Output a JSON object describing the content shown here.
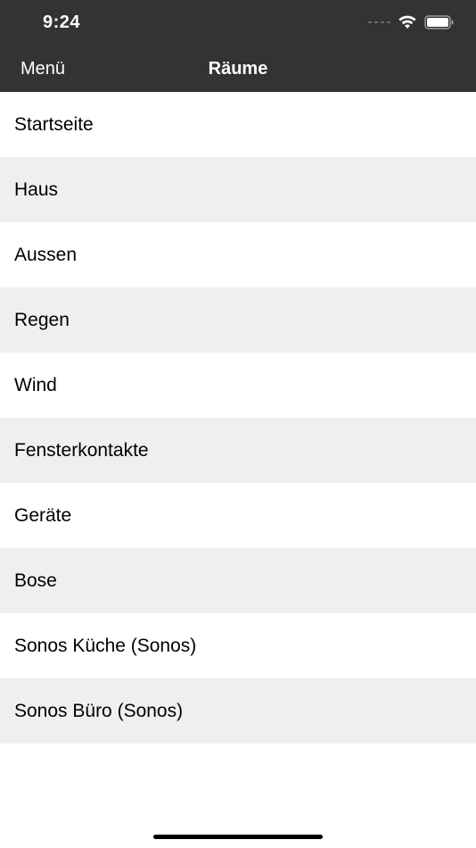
{
  "status_bar": {
    "time": "9:24"
  },
  "nav": {
    "menu_label": "Menü",
    "title": "Räume"
  },
  "rooms": [
    {
      "label": "Startseite"
    },
    {
      "label": "Haus"
    },
    {
      "label": "Aussen"
    },
    {
      "label": "Regen"
    },
    {
      "label": "Wind"
    },
    {
      "label": "Fensterkontakte"
    },
    {
      "label": "Geräte"
    },
    {
      "label": "Bose"
    },
    {
      "label": "Sonos Küche (Sonos)"
    },
    {
      "label": "Sonos Büro (Sonos)"
    }
  ],
  "icons": {
    "wifi": "wifi-icon",
    "battery": "battery-icon",
    "signal": "cellular-signal-icon"
  },
  "colors": {
    "nav_background": "#333333",
    "row_alt": "#efefef",
    "row": "#ffffff"
  }
}
